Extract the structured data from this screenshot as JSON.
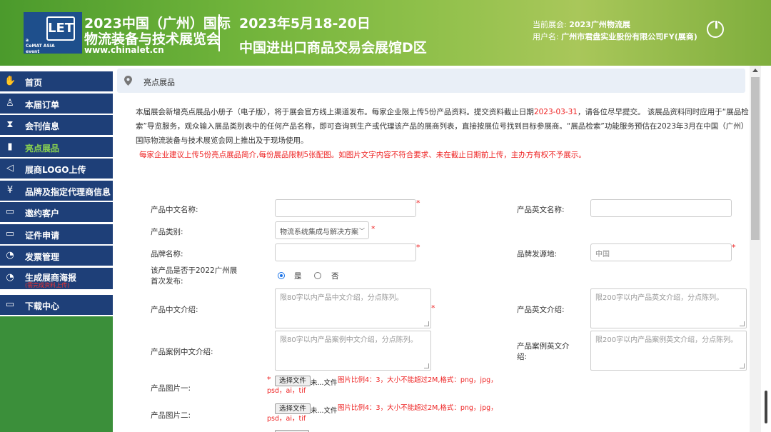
{
  "header": {
    "logo_let": "LET",
    "logo_cemat": "a\nCeMAT ASIA\nevent",
    "title_line1": "2023中国（广州）国际",
    "title_line2": "物流装备与技术展览会",
    "url": "www.chinalet.cn",
    "date": "2023年5月18-20日",
    "venue": "中国进出口商品交易会展馆D区",
    "current_expo_label": "当前展会:",
    "current_expo_value": "2023广州物流展",
    "user_label": "用户名:",
    "user_value": "广州市君盘实业股份有限公司FY(展商)",
    "colors": {
      "header_green": "#6fb33a",
      "logo_blue": "#1e4f8c"
    }
  },
  "sidebar": {
    "items": [
      {
        "label": "首页",
        "icon": "handshake-icon",
        "glyph": "✋"
      },
      {
        "label": "本届订单",
        "icon": "user-icon",
        "glyph": "♙"
      },
      {
        "label": "会刊信息",
        "icon": "hourglass-icon",
        "glyph": "⧗"
      },
      {
        "label": "亮点展品",
        "icon": "bar-chart-icon",
        "glyph": "▮"
      },
      {
        "label": "展商LOGO上传",
        "icon": "megaphone-icon",
        "glyph": "◁"
      },
      {
        "label": "品牌及指定代理商信息",
        "icon": "money-icon",
        "glyph": "¥"
      },
      {
        "label": "邀约客户",
        "icon": "folder-icon",
        "glyph": "▭"
      },
      {
        "label": "证件申请",
        "icon": "folder-icon",
        "glyph": "▭"
      },
      {
        "label": "发票管理",
        "icon": "pie-chart-icon",
        "glyph": "◔"
      },
      {
        "label": "生成展商海报",
        "icon": "pie-chart-icon",
        "glyph": "◔",
        "sub": "(需完成资料上传)"
      },
      {
        "label": "下载中心",
        "icon": "folder-icon",
        "glyph": "▭"
      }
    ],
    "active_index": 3,
    "colors": {
      "item_bg": "#1e3f78",
      "active_text": "#8ad34f",
      "bottom_green": "#3b8f3a"
    }
  },
  "main": {
    "breadcrumb": "亮点展品",
    "intro_part1": "本届展会新增亮点展品小册子（电子版），将于展会官方线上渠道发布。每家企业限上传5份产品资料。提交资料截止日期",
    "intro_deadline": "2023-03-31",
    "intro_part2": "，请各位尽早提交。 该展品资料同时应用于“展品检索”导览服务，观众输入展品类别表中的任何产品名称，即可查询到生产或代理该产品的展商列表，直接按展位号找到目标参展商。“展品检索”功能服务预估在2023年3月在中国（广州）国际物流装备与技术展览会网上推出及于现场使用。",
    "notice": "每家企业建议上传5份亮点展品简介,每份展品限制5张配图。如图片文字内容不符合要求、未在截止日期前上传，主办方有权不予展示。",
    "form": {
      "cn_name_label": "产品中文名称:",
      "en_name_label": "产品英文名称:",
      "category_label": "产品类别:",
      "category_value": "物流系统集成与解决方案",
      "brand_label": "品牌名称:",
      "origin_label": "品牌发源地:",
      "origin_placeholder": "中国",
      "first_release_label": "该产品是否于2022广州展首次发布:",
      "yes_label": "是",
      "no_label": "否",
      "cn_intro_label": "产品中文介绍:",
      "cn_intro_placeholder": "限80字以内产品中文介绍，分点陈列。",
      "en_intro_label": "产品英文介绍:",
      "en_intro_placeholder": "限200字以内产品英文介绍，分点陈列。",
      "case_cn_label": "产品案例中文介绍:",
      "case_cn_placeholder": "限80字以内产品案例中文介绍，分点陈列。",
      "case_en_label": "产品案例英文介绍:",
      "case_en_placeholder": "限200字以内产品案例英文介绍，分点陈列。",
      "image1_label": "产品图片一:",
      "image2_label": "产品图片二:",
      "choose_file": "选择文件",
      "no_file": "未...文件",
      "image_hint": "图片比例4：3，大小不能超过2M,格式：png，jpg，psd，ai，tif",
      "required_mark": "*"
    }
  }
}
